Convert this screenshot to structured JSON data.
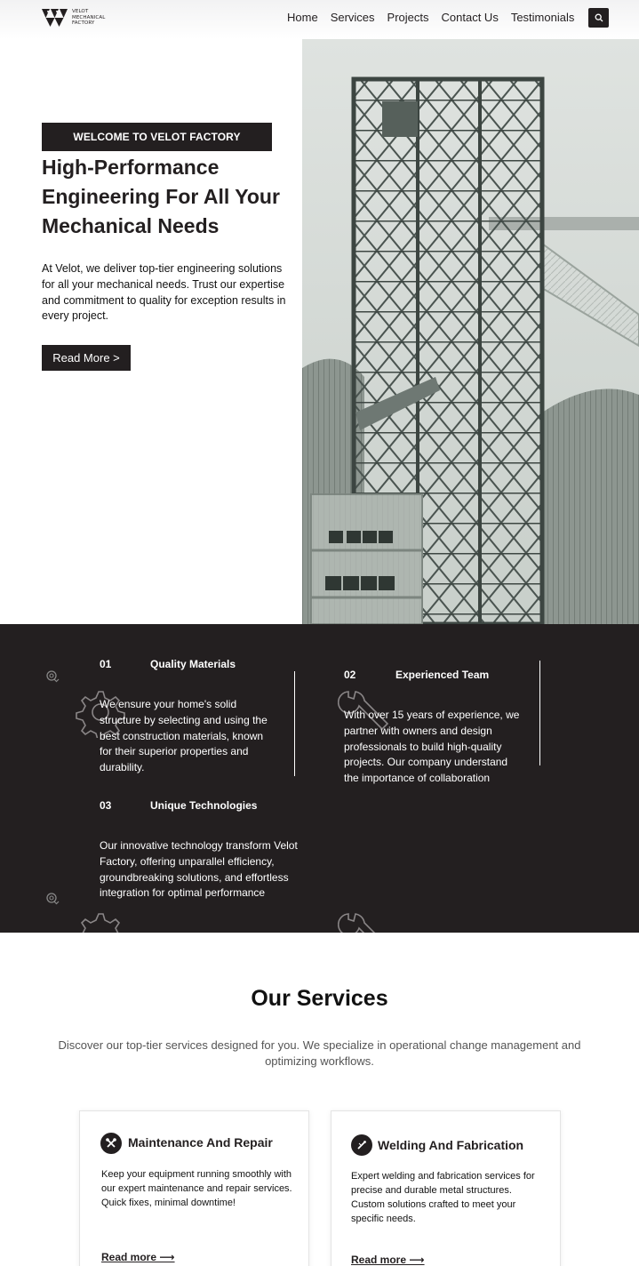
{
  "header": {
    "logo": {
      "line1": "VELOT",
      "line2": "MECHANICAL",
      "line3": "FACTORY"
    },
    "nav": [
      "Home",
      "Services",
      "Projects",
      "Contact Us",
      "Testimonials"
    ],
    "search_icon": "search-icon"
  },
  "hero": {
    "badge": "WELCOME TO VELOT FACTORY",
    "title": "High-Performance Engineering For All Your Mechanical Needs",
    "description": "At Velot, we deliver top-tier engineering solutions for all your mechanical needs. Trust our expertise and commitment to quality for exception results in every project.",
    "button": "Read More  >"
  },
  "features": [
    {
      "num": "01",
      "title": "Quality Materials",
      "desc": "We ensure your home's solid structure by selecting and using the best construction materials, known for their superior properties and durability."
    },
    {
      "num": "02",
      "title": "Experienced Team",
      "desc": "With over 15 years of experience, we partner with owners and design professionals to build high-quality projects. Our company understand the importance of collaboration"
    },
    {
      "num": "03",
      "title": "Unique Technologies",
      "desc": "Our innovative technology transform Velot Factory, offering unparallel efficiency, groundbreaking solutions, and effortless integration for optimal performance"
    }
  ],
  "services": {
    "title": "Our Services",
    "description": "Discover our top-tier services designed for you. We specialize in operational change management and optimizing workflows.",
    "cards": [
      {
        "icon": "tools-icon",
        "title": "Maintenance And Repair",
        "desc": "Keep your equipment running smoothly with our expert maintenance and repair services. Quick fixes, minimal downtime!",
        "link": "Read more ⟶"
      },
      {
        "icon": "welding-icon",
        "title": "Welding And Fabrication",
        "desc": "Expert welding and fabrication services for precise and durable metal structures. Custom solutions crafted to meet your specific needs.",
        "link": "Read more ⟶"
      }
    ]
  },
  "colors": {
    "dark": "#231f20",
    "white": "#ffffff",
    "muted": "#555555"
  }
}
